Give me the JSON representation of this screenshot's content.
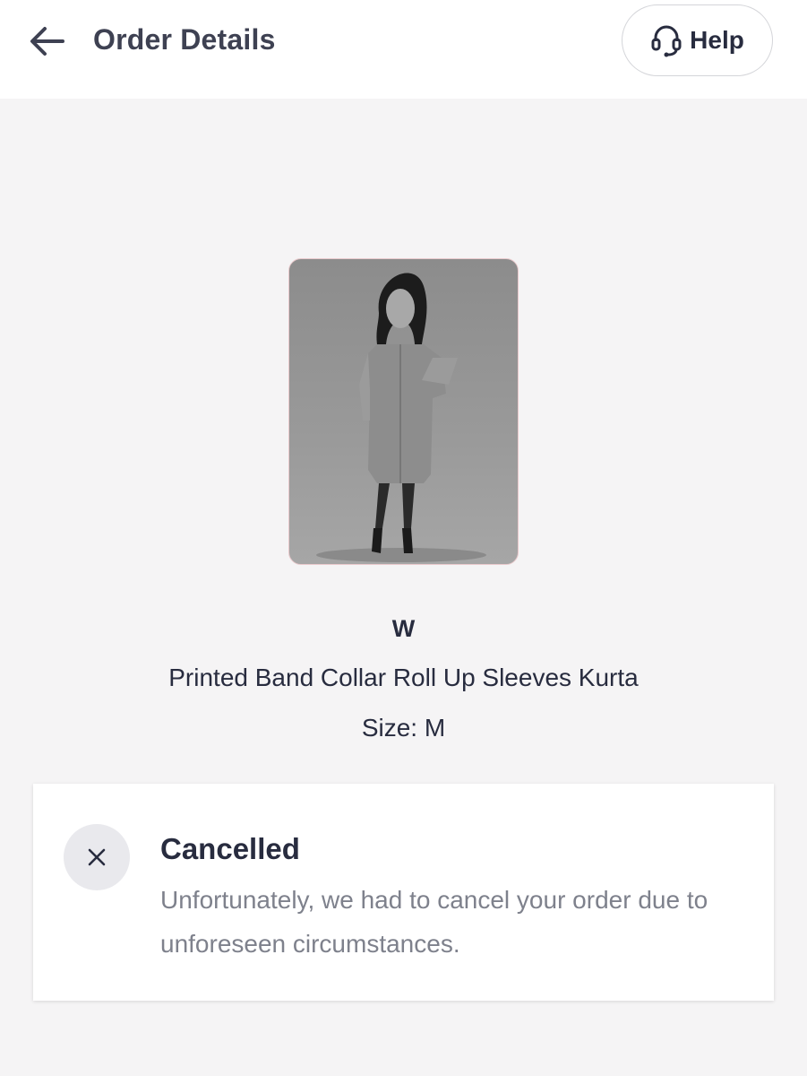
{
  "header": {
    "title": "Order Details",
    "back_icon": "arrow-left-icon",
    "help_label": "Help",
    "help_icon": "headset-icon"
  },
  "product": {
    "brand": "W",
    "name": "Printed Band Collar Roll Up Sleeves Kurta",
    "size_text": "Size: M"
  },
  "status": {
    "icon": "close-icon",
    "title": "Cancelled",
    "message": "Unfortunately, we had to cancel your order due to unforeseen circumstances."
  },
  "colors": {
    "page_background": "#f5f4f5",
    "card_background": "#ffffff",
    "primary_text": "#282c3f",
    "secondary_text": "#7e818c"
  }
}
